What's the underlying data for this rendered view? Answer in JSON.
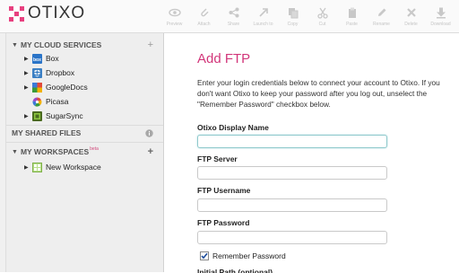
{
  "app": {
    "logo_text": "OTIXO"
  },
  "toolbar": [
    {
      "label": "Preview",
      "icon": "eye-icon"
    },
    {
      "label": "Attach",
      "icon": "attach-icon"
    },
    {
      "label": "Share",
      "icon": "share-icon"
    },
    {
      "label": "Launch to",
      "icon": "launch-icon"
    },
    {
      "label": "Copy",
      "icon": "copy-icon"
    },
    {
      "label": "Cut",
      "icon": "scissors-icon"
    },
    {
      "label": "Paste",
      "icon": "paste-icon"
    },
    {
      "label": "Rename",
      "icon": "pencil-icon"
    },
    {
      "label": "Delete",
      "icon": "delete-icon"
    },
    {
      "label": "Download",
      "icon": "download-icon"
    }
  ],
  "sidebar": {
    "cloud": {
      "title": "MY CLOUD SERVICES",
      "action": "+",
      "items": [
        {
          "label": "Box",
          "icon": "box-icon",
          "color": "#2a74c8"
        },
        {
          "label": "Dropbox",
          "icon": "dropbox-icon",
          "color": "#3b7fc4"
        },
        {
          "label": "GoogleDocs",
          "icon": "googledocs-icon",
          "color": "#4a8a3a"
        },
        {
          "label": "Picasa",
          "icon": "picasa-icon",
          "color": "#ffffff"
        },
        {
          "label": "SugarSync",
          "icon": "sugarsync-icon",
          "color": "#6a9a2a"
        }
      ]
    },
    "shared": {
      "title": "MY SHARED FILES"
    },
    "workspaces": {
      "title": "MY WORKSPACES",
      "badge": "beta",
      "action": "+",
      "items": [
        {
          "label": "New Workspace",
          "icon": "workspace-icon"
        }
      ]
    }
  },
  "form": {
    "title": "Add FTP",
    "intro": "Enter your login credentials below to connect your account to Otixo. If you don't want Otixo to keep your password after you log out, unselect the \"Remember Password\" checkbox below.",
    "fields": [
      {
        "label": "Otixo Display Name",
        "value": ""
      },
      {
        "label": "FTP Server",
        "value": ""
      },
      {
        "label": "FTP Username",
        "value": ""
      },
      {
        "label": "FTP Password",
        "value": ""
      }
    ],
    "remember_label": "Remember Password",
    "remember_checked": true,
    "next_label": "Initial Path (optional)"
  },
  "colors": {
    "accent": "#d2367a",
    "focus_border": "#8fc9cc"
  }
}
